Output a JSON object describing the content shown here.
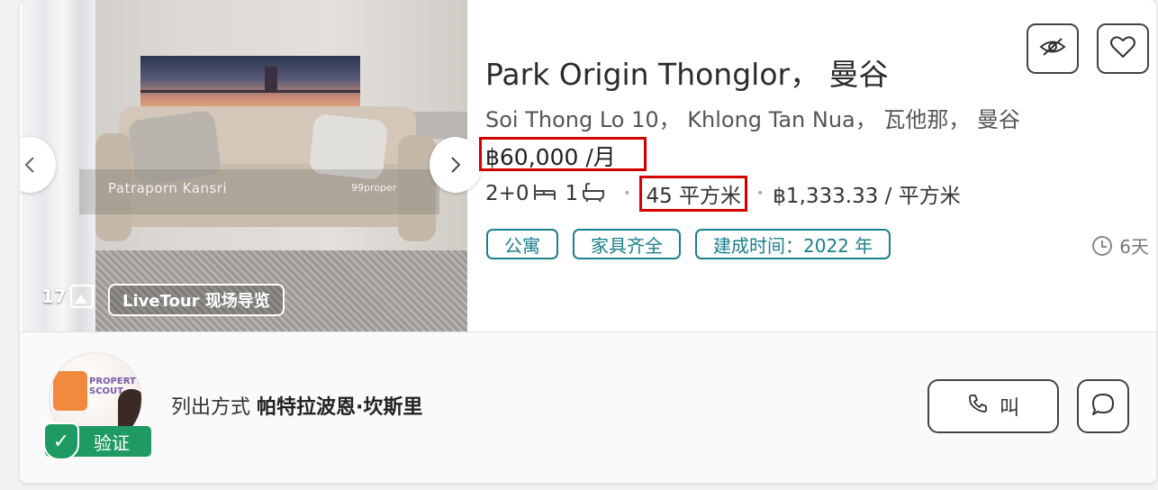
{
  "listing": {
    "title": "Park Origin Thonglor， 曼谷",
    "address": "Soi Thong Lo 10， Khlong Tan Nua， 瓦他那， 曼谷",
    "price": "฿60,000 /月",
    "bedrooms": "2+0",
    "bathrooms": "1",
    "area": "45 平方米",
    "price_per_area": "฿1,333.33 / 平方米",
    "tags": [
      "公寓",
      "家具齐全",
      "建成时间：2022 年"
    ],
    "posted_age": "6天"
  },
  "photo": {
    "count": "17",
    "livetour_label": "LiveTour 现场导览",
    "watermark_name": "Patraporn Kansri",
    "watermark_brand": "99proper"
  },
  "agent": {
    "listed_by_prefix": "列出方式",
    "name": "帕特拉波恩·坎斯里",
    "verified_label": "验证",
    "avatar_logo_text": "PROPERTY SCOUT"
  },
  "actions": {
    "call_label": "叫"
  },
  "colors": {
    "accent_teal": "#1b7f8c",
    "verified_green": "#1f9a62",
    "highlight_red": "#d40000"
  },
  "icons": [
    "image-count-icon",
    "chevron-left-icon",
    "chevron-right-icon",
    "eye-off-icon",
    "heart-icon",
    "bed-icon",
    "bath-icon",
    "clock-icon",
    "check-shield-icon",
    "phone-icon",
    "chat-bubble-icon"
  ]
}
